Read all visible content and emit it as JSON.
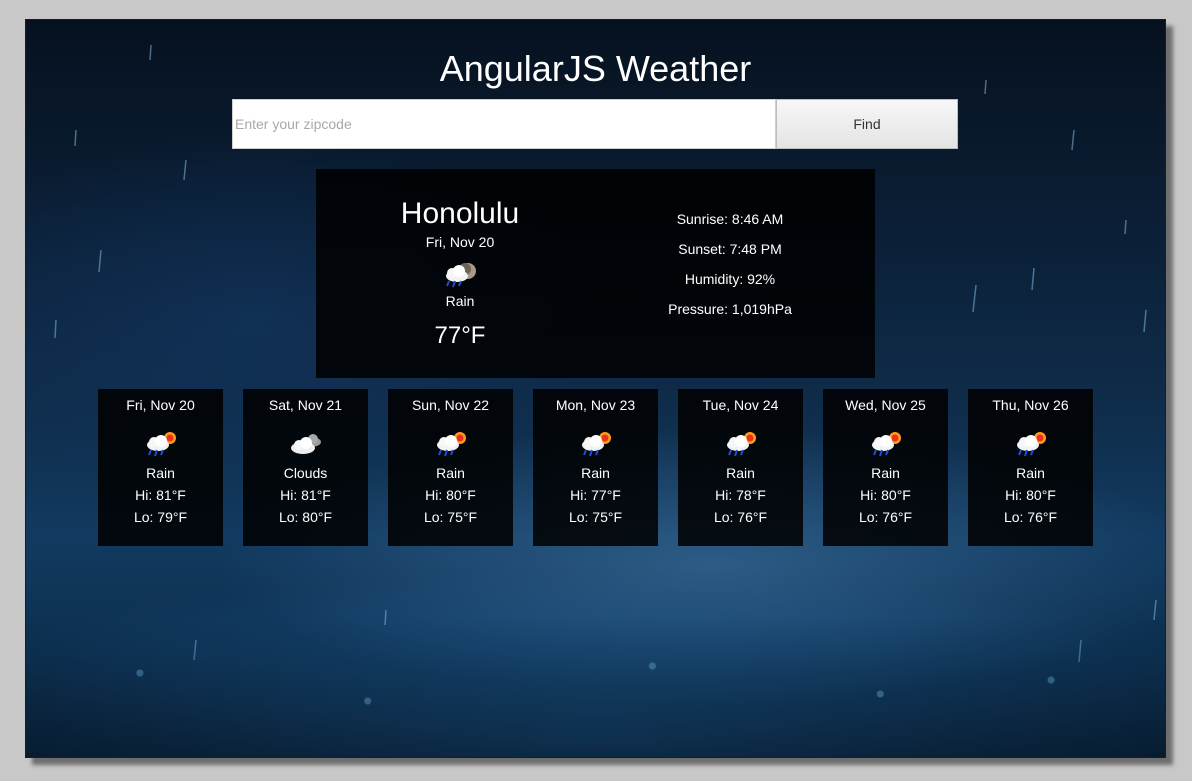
{
  "app": {
    "title": "AngularJS Weather"
  },
  "search": {
    "placeholder": "Enter your zipcode",
    "value": "",
    "button_label": "Find"
  },
  "current": {
    "city": "Honolulu",
    "date": "Fri, Nov 20",
    "icon": "rain-cloud-moon-icon",
    "condition": "Rain",
    "temperature": "77°F",
    "sunrise": "Sunrise: 8:46 AM",
    "sunset": "Sunset: 7:48 PM",
    "humidity": "Humidity: 92%",
    "pressure": "Pressure: 1,019hPa"
  },
  "forecast": [
    {
      "date": "Fri, Nov 20",
      "icon": "rain-cloud-sun-icon",
      "condition": "Rain",
      "hi": "Hi: 81°F",
      "lo": "Lo: 79°F"
    },
    {
      "date": "Sat, Nov 21",
      "icon": "clouds-icon",
      "condition": "Clouds",
      "hi": "Hi: 81°F",
      "lo": "Lo: 80°F"
    },
    {
      "date": "Sun, Nov 22",
      "icon": "rain-cloud-sun-icon",
      "condition": "Rain",
      "hi": "Hi: 80°F",
      "lo": "Lo: 75°F"
    },
    {
      "date": "Mon, Nov 23",
      "icon": "rain-cloud-sun-icon",
      "condition": "Rain",
      "hi": "Hi: 77°F",
      "lo": "Lo: 75°F"
    },
    {
      "date": "Tue, Nov 24",
      "icon": "rain-cloud-sun-icon",
      "condition": "Rain",
      "hi": "Hi: 78°F",
      "lo": "Lo: 76°F"
    },
    {
      "date": "Wed, Nov 25",
      "icon": "rain-cloud-sun-icon",
      "condition": "Rain",
      "hi": "Hi: 80°F",
      "lo": "Lo: 76°F"
    },
    {
      "date": "Thu, Nov 26",
      "icon": "rain-cloud-sun-icon",
      "condition": "Rain",
      "hi": "Hi: 80°F",
      "lo": "Lo: 76°F"
    }
  ],
  "colors": {
    "panel_background": "#000000",
    "text": "#ffffff",
    "background_top": "#06111f",
    "background_bottom": "#123a60"
  }
}
